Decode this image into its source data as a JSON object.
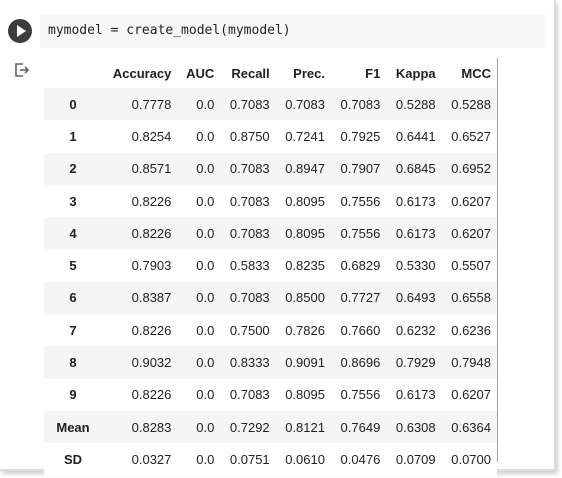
{
  "code": {
    "line": "mymodel = create_model(mymodel)"
  },
  "icons": {
    "run": "play-icon",
    "output": "output-arrow-icon"
  },
  "table": {
    "index_header": "",
    "columns": [
      "Accuracy",
      "AUC",
      "Recall",
      "Prec.",
      "F1",
      "Kappa",
      "MCC"
    ],
    "rows": [
      {
        "index": "0",
        "values": [
          "0.7778",
          "0.0",
          "0.7083",
          "0.7083",
          "0.7083",
          "0.5288",
          "0.5288"
        ]
      },
      {
        "index": "1",
        "values": [
          "0.8254",
          "0.0",
          "0.8750",
          "0.7241",
          "0.7925",
          "0.6441",
          "0.6527"
        ]
      },
      {
        "index": "2",
        "values": [
          "0.8571",
          "0.0",
          "0.7083",
          "0.8947",
          "0.7907",
          "0.6845",
          "0.6952"
        ]
      },
      {
        "index": "3",
        "values": [
          "0.8226",
          "0.0",
          "0.7083",
          "0.8095",
          "0.7556",
          "0.6173",
          "0.6207"
        ]
      },
      {
        "index": "4",
        "values": [
          "0.8226",
          "0.0",
          "0.7083",
          "0.8095",
          "0.7556",
          "0.6173",
          "0.6207"
        ]
      },
      {
        "index": "5",
        "values": [
          "0.7903",
          "0.0",
          "0.5833",
          "0.8235",
          "0.6829",
          "0.5330",
          "0.5507"
        ]
      },
      {
        "index": "6",
        "values": [
          "0.8387",
          "0.0",
          "0.7083",
          "0.8500",
          "0.7727",
          "0.6493",
          "0.6558"
        ]
      },
      {
        "index": "7",
        "values": [
          "0.8226",
          "0.0",
          "0.7500",
          "0.7826",
          "0.7660",
          "0.6232",
          "0.6236"
        ]
      },
      {
        "index": "8",
        "values": [
          "0.9032",
          "0.0",
          "0.8333",
          "0.9091",
          "0.8696",
          "0.7929",
          "0.7948"
        ]
      },
      {
        "index": "9",
        "values": [
          "0.8226",
          "0.0",
          "0.7083",
          "0.8095",
          "0.7556",
          "0.6173",
          "0.6207"
        ]
      },
      {
        "index": "Mean",
        "values": [
          "0.8283",
          "0.0",
          "0.7292",
          "0.8121",
          "0.7649",
          "0.6308",
          "0.6364"
        ]
      },
      {
        "index": "SD",
        "values": [
          "0.0327",
          "0.0",
          "0.0751",
          "0.0610",
          "0.0476",
          "0.0709",
          "0.0700"
        ]
      }
    ]
  }
}
